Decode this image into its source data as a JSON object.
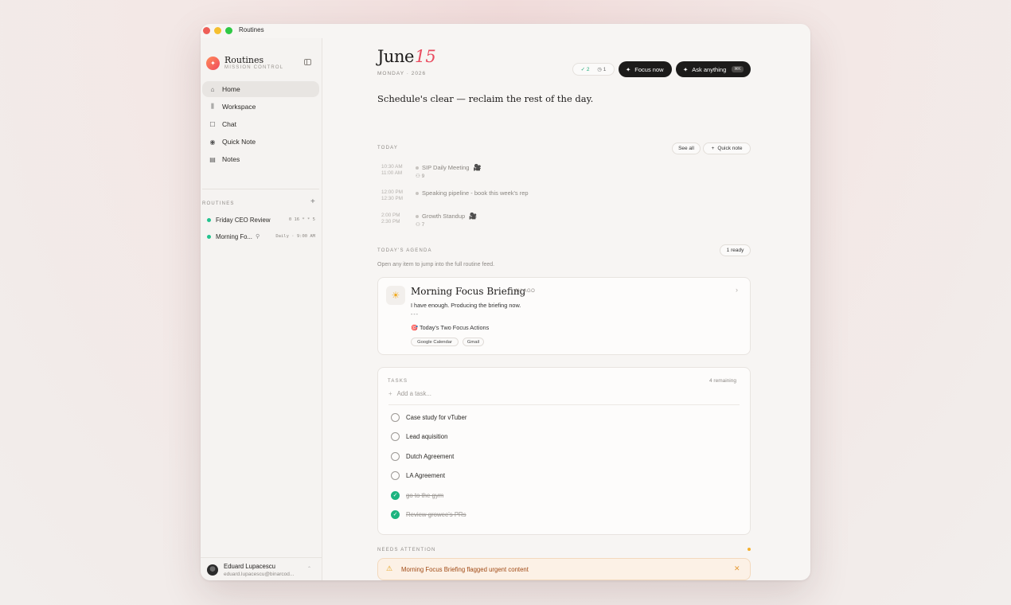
{
  "window": {
    "title": "Routines"
  },
  "sidebar": {
    "brand_name": "Routines",
    "brand_sub": "MISSION CONTROL",
    "nav": [
      {
        "label": "Home",
        "icon": "home-icon",
        "glyph": "⌂"
      },
      {
        "label": "Workspace",
        "icon": "library-icon",
        "glyph": "⫼"
      },
      {
        "label": "Chat",
        "icon": "chat-icon",
        "glyph": "☐"
      },
      {
        "label": "Quick Note",
        "icon": "mic-icon",
        "glyph": "◉"
      },
      {
        "label": "Notes",
        "icon": "document-icon",
        "glyph": "▤"
      }
    ],
    "routines_label": "ROUTINES",
    "routines": [
      {
        "name": "Friday CEO Review",
        "meta": "0 16 * * 5"
      },
      {
        "name": "Morning Fo...",
        "meta": "Daily · 9:00 AM"
      }
    ],
    "user": {
      "name": "Eduard Lupacescu",
      "email": "eduard.lupacescu@binarcod..."
    }
  },
  "header": {
    "month": "June",
    "day": "15",
    "sub": "MONDAY · 2026",
    "counter_done": "2",
    "counter_pending": "1",
    "focus_label": "Focus now",
    "ask_label": "Ask anything",
    "ask_kbd": "⌘K"
  },
  "headline": "Schedule's clear — reclaim the rest of the day.",
  "today": {
    "label": "TODAY",
    "see_all": "See all",
    "quick_note": "Quick note",
    "events": [
      {
        "start": "10:30 AM",
        "end": "11:00 AM",
        "title": "SIP Daily Meeting",
        "people": "9",
        "video": true
      },
      {
        "start": "12:00 PM",
        "end": "12:30 PM",
        "title": "Speaking pipeline - book this week's rep",
        "people": "",
        "video": false
      },
      {
        "start": "2:00 PM",
        "end": "2:30 PM",
        "title": "Growth Standup",
        "people": "7",
        "video": true
      }
    ]
  },
  "agenda": {
    "label": "TODAY'S AGENDA",
    "ready": "1 ready",
    "subtext": "Open any item to jump into the full routine feed.",
    "brief": {
      "title": "Morning Focus Briefing",
      "ago": "6H AGO",
      "line1": "I have enough. Producing the briefing now.",
      "line2": "---",
      "line3": "🎯 Today's Two Focus Actions",
      "tags": [
        "Google Calendar",
        "Gmail"
      ]
    }
  },
  "tasks": {
    "label": "TASKS",
    "remaining": "4 remaining",
    "placeholder": "Add a task...",
    "items": [
      {
        "label": "Case study for vTuber",
        "done": false
      },
      {
        "label": "Lead aquisition",
        "done": false
      },
      {
        "label": "Dutch Agreement",
        "done": false
      },
      {
        "label": "LA Agreement",
        "done": false
      },
      {
        "label": "go to the gym",
        "done": true
      },
      {
        "label": "Review growee's PRs",
        "done": true
      }
    ]
  },
  "attention": {
    "label": "NEEDS ATTENTION",
    "alert": "Morning Focus Briefing flagged urgent content"
  },
  "colors": {
    "accent": "#e94b5f",
    "success": "#1cb47f",
    "warning": "#e5a11a"
  }
}
